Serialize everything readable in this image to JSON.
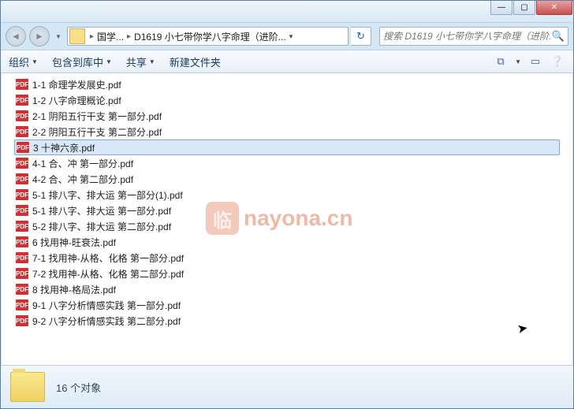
{
  "caption": {
    "min": "—",
    "max": "▢",
    "close": "✕"
  },
  "nav": {
    "back": "◄",
    "fwd": "►",
    "dd": "▼"
  },
  "breadcrumb": {
    "sep": "▸",
    "item1": "国学...",
    "item2": "D1619 小七带你学八字命理（进阶...",
    "dd": "▾"
  },
  "refresh": "↻",
  "search": {
    "placeholder": "搜索 D1619 小七带你学八字命理（进阶...",
    "icon": "🔍"
  },
  "toolbar": {
    "organize": "组织",
    "include": "包含到库中",
    "share": "共享",
    "newfolder": "新建文件夹",
    "view_ic": "⧉",
    "help_ic": "❔"
  },
  "files": [
    {
      "name": "1-1 命理学发展史.pdf",
      "selected": false
    },
    {
      "name": "1-2 八字命理概论.pdf",
      "selected": false
    },
    {
      "name": "2-1 阴阳五行干支 第一部分.pdf",
      "selected": false
    },
    {
      "name": "2-2 阴阳五行干支 第二部分.pdf",
      "selected": false
    },
    {
      "name": "3 十神六亲.pdf",
      "selected": true
    },
    {
      "name": "4-1 合、冲 第一部分.pdf",
      "selected": false
    },
    {
      "name": "4-2 合、冲 第二部分.pdf",
      "selected": false
    },
    {
      "name": "5-1 排八字、排大运 第一部分(1).pdf",
      "selected": false
    },
    {
      "name": "5-1 排八字、排大运 第一部分.pdf",
      "selected": false
    },
    {
      "name": "5-2 排八字、排大运 第二部分.pdf",
      "selected": false
    },
    {
      "name": "6 找用神-旺衰法.pdf",
      "selected": false
    },
    {
      "name": "7-1 找用神-从格、化格 第一部分.pdf",
      "selected": false
    },
    {
      "name": "7-2 找用神-从格、化格 第二部分.pdf",
      "selected": false
    },
    {
      "name": "8 找用神-格局法.pdf",
      "selected": false
    },
    {
      "name": "9-1 八字分析情感实践 第一部分.pdf",
      "selected": false
    },
    {
      "name": "9-2 八字分析情感实践 第二部分.pdf",
      "selected": false
    }
  ],
  "pdf_badge": "PDF",
  "watermark": {
    "badge": "临",
    "text": "nayona.cn"
  },
  "status": {
    "count": "16 个对象"
  },
  "cursor": "↖"
}
